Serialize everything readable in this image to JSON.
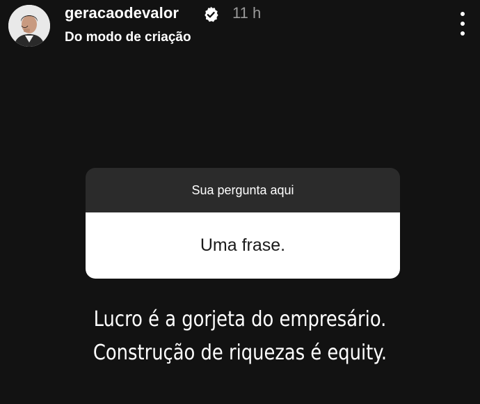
{
  "header": {
    "username": "geracaodevalor",
    "verified_icon": "verified-badge-icon",
    "time": "11 h",
    "subtitle": "Do modo de criação",
    "menu_icon": "more-vertical-icon"
  },
  "sticker": {
    "prompt": "Sua pergunta aqui",
    "answer": "Uma frase."
  },
  "caption": {
    "line1": "Lucro é a gorjeta do empresário.",
    "line2": "Construção de riquezas é equity."
  },
  "colors": {
    "background": "#121212",
    "sticker_header": "#2b2b2b",
    "sticker_body": "#ffffff",
    "time_text": "#9a9a9a"
  }
}
